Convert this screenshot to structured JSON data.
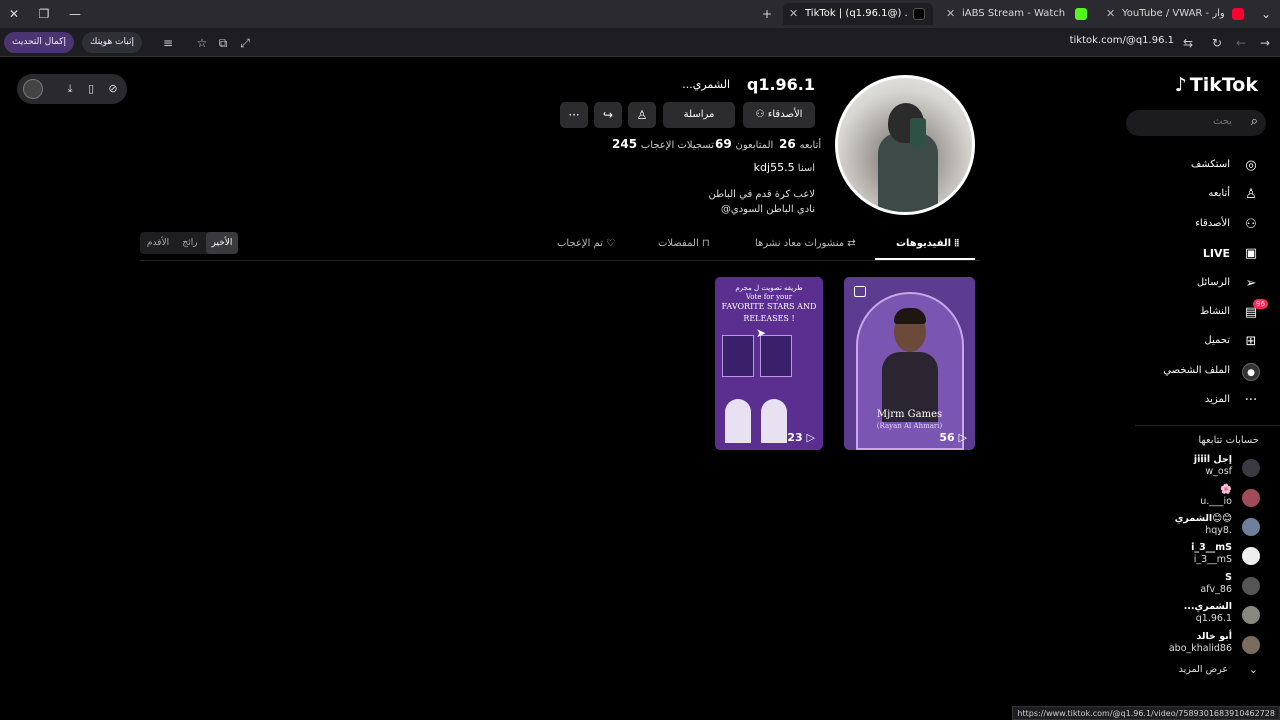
{
  "browser": {
    "tabs": [
      {
        "title": "YouTube / VWAR - في وار",
        "active": false
      },
      {
        "title": "iABS Stream - Watch Live on Ki",
        "active": false
      },
      {
        "title": "TikTok | (q1.96.1@) ...الشمري",
        "active": true
      }
    ],
    "new_tab": "+",
    "url": "tiktok.com/@q1.96.1",
    "pill_update": "إكمال التحديث",
    "pill_verify": "إثبات هويتك"
  },
  "sidebar": {
    "brand": "TikTok",
    "search_placeholder": "بحث",
    "nav": [
      {
        "label": "استكشف",
        "icon": "compass-icon"
      },
      {
        "label": "أتابعه",
        "icon": "user-follow-icon"
      },
      {
        "label": "الأصدقاء",
        "icon": "friends-icon"
      },
      {
        "label": "LIVE",
        "icon": "live-icon"
      },
      {
        "label": "الرسائل",
        "icon": "messages-icon"
      },
      {
        "label": "النشاط",
        "icon": "activity-icon",
        "badge": "96"
      },
      {
        "label": "تحميل",
        "icon": "upload-icon"
      },
      {
        "label": "الملف الشخصي",
        "icon": "profile-icon"
      },
      {
        "label": "المزيد",
        "icon": "more-icon"
      }
    ],
    "following_title": "حسابات تتابعها",
    "following": [
      {
        "name": "jiiil إجل",
        "user": "w_osf"
      },
      {
        "name": "🌸",
        "user": "u.___io"
      },
      {
        "name": "الشمري😊😊",
        "user": "hqy8."
      },
      {
        "name": "i_3__mS",
        "user": "i_3__mS"
      },
      {
        "name": "S",
        "user": "afv_86"
      },
      {
        "name": "...الشمري",
        "user": "q1.96.1"
      },
      {
        "name": "أبو خالد",
        "user": "abo_khalid86"
      }
    ],
    "see_more": "عرض المزيد"
  },
  "profile": {
    "handle": "q1.96.1",
    "nickname": "...الشمري",
    "btn_friends": "الأصدقاء",
    "btn_message": "مراسلة",
    "following_count": "26",
    "following_label": "أتابعه",
    "followers_count": "69",
    "followers_label": "المتابعون",
    "likes_count": "245",
    "likes_label": "تسجيلات الإعجاب",
    "snap_label": "اسنا",
    "snap_value": "kdj55.5",
    "bio_line1": "لاعب كرة قدم في الباطن",
    "bio_line2": "@نادي الباطن السودي"
  },
  "tabs": {
    "videos": "الفيديوهات",
    "reposts": "منشورات معاد نشرها",
    "favorites": "المفضلات",
    "liked": "تم الإعجاب"
  },
  "sort": {
    "latest": "الأخير",
    "popular": "رائج",
    "oldest": "الأقدم"
  },
  "videos": [
    {
      "plays": "56",
      "title": "Mjrm Games",
      "subtitle": "(Rayan Al Ahmari)"
    },
    {
      "plays": "23",
      "title_top": "طريقه تصويت ل مجرم",
      "title": "FAVORITE STARS AND RELEASES !",
      "vote": "Vote for your"
    }
  ],
  "status_url": "https://www.tiktok.com/@q1.96.1/video/7589301683910462728"
}
